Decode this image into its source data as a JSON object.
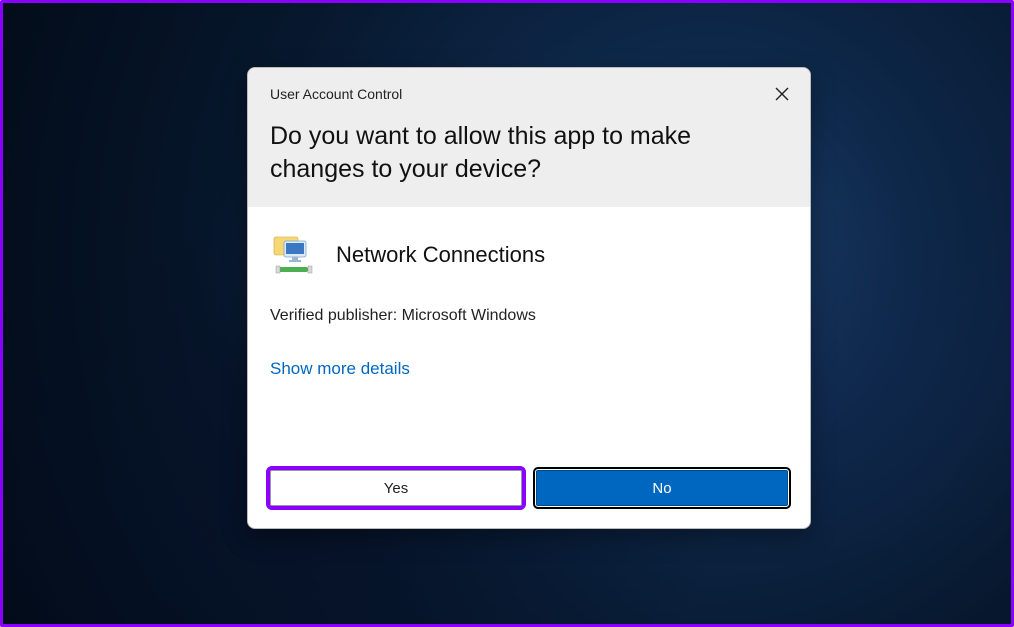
{
  "dialog": {
    "title": "User Account Control",
    "question": "Do you want to allow this app to make changes to your device?",
    "app_name": "Network Connections",
    "publisher_line": "Verified publisher: Microsoft Windows",
    "details_link": "Show more details",
    "buttons": {
      "yes": "Yes",
      "no": "No"
    },
    "icon_name": "network-connections-icon"
  },
  "colors": {
    "accent": "#0067c0",
    "highlight": "#8a00ff"
  }
}
